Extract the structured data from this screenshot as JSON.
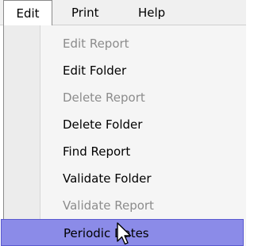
{
  "menubar": {
    "items": [
      {
        "label": "Edit"
      },
      {
        "label": "Print"
      },
      {
        "label": "Help"
      }
    ]
  },
  "edit_menu": {
    "items": [
      {
        "label": "Edit Report",
        "enabled": false
      },
      {
        "label": "Edit Folder",
        "enabled": true
      },
      {
        "label": "Delete Report",
        "enabled": false
      },
      {
        "label": "Delete Folder",
        "enabled": true
      },
      {
        "label": "Find Report",
        "enabled": true
      },
      {
        "label": "Validate Folder",
        "enabled": true
      },
      {
        "label": "Validate Report",
        "enabled": false
      },
      {
        "label": "Periodic Dates",
        "enabled": true,
        "highlighted": true
      }
    ]
  },
  "colors": {
    "highlight": "#8b8be8",
    "disabled_text": "#8c8c8c"
  },
  "cursor": {
    "icon": "arrow-pointer-icon"
  }
}
